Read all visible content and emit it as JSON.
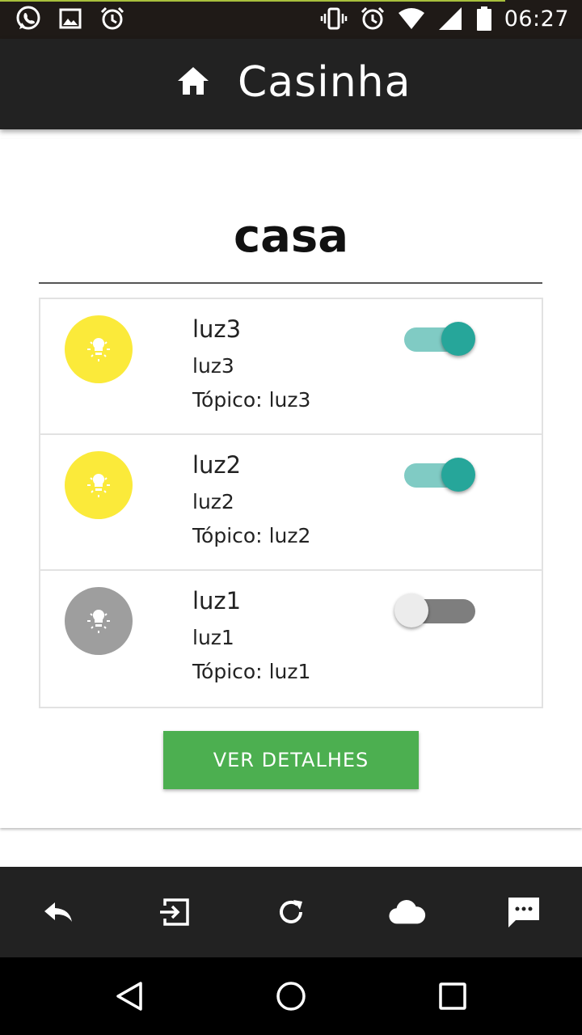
{
  "status_bar": {
    "time": "06:27",
    "left_icons": [
      "whatsapp-icon",
      "image-icon",
      "alarm-icon"
    ],
    "right_icons": [
      "vibrate-icon",
      "alarm-icon",
      "wifi-icon",
      "signal-icon",
      "battery-icon"
    ]
  },
  "app_bar": {
    "title": "Casinha",
    "icon": "home-icon"
  },
  "card": {
    "title": "casa",
    "devices": [
      {
        "name": "luz3",
        "description": "luz3",
        "topic_label": "Tópico:",
        "topic": "luz3",
        "state": "on",
        "icon": "lightbulb-icon"
      },
      {
        "name": "luz2",
        "description": "luz2",
        "topic_label": "Tópico:",
        "topic": "luz2",
        "state": "on",
        "icon": "lightbulb-icon"
      },
      {
        "name": "luz1",
        "description": "luz1",
        "topic_label": "Tópico:",
        "topic": "luz1",
        "state": "off",
        "icon": "lightbulb-icon"
      }
    ],
    "details_button": "VER DETALHES"
  },
  "bottom_bar": {
    "icons": [
      "reply-icon",
      "exit-icon",
      "refresh-icon",
      "cloud-icon",
      "chat-icon"
    ]
  },
  "nav_bar": {
    "icons": [
      "back-icon",
      "home-icon",
      "recents-icon"
    ]
  },
  "colors": {
    "bulb_on": "#fbea3a",
    "bulb_off": "#9e9e9e",
    "switch_on": "#26a69a",
    "button": "#4caf50",
    "bar": "#222222"
  }
}
